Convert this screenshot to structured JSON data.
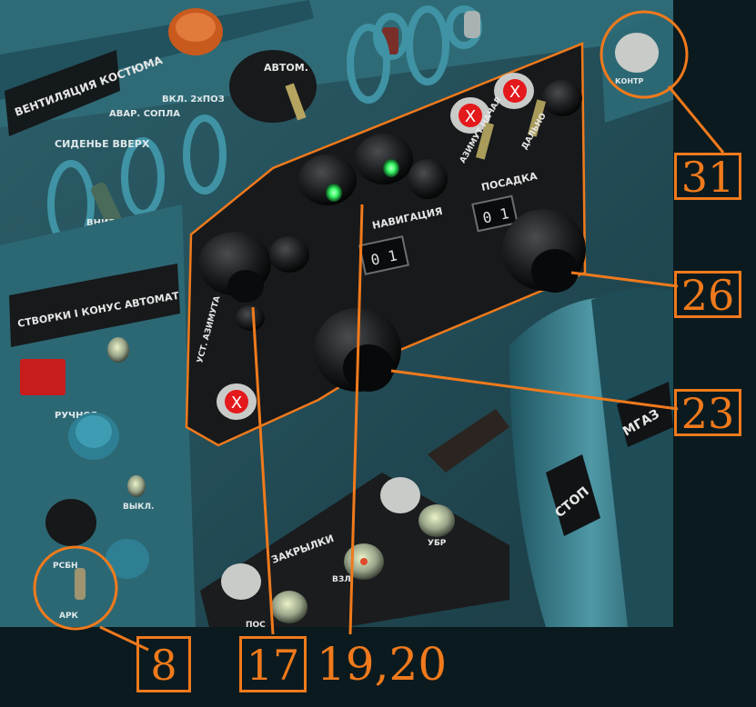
{
  "callouts": {
    "c31": "31",
    "c26": "26",
    "c23": "23",
    "c8": "8",
    "c17": "17",
    "c1920": "19,20"
  },
  "panel_labels": {
    "suit_vent": "ВЕНТИЛЯЦИЯ КОСТЮМА",
    "auto": "АВТОМ.",
    "manual_left": "РУЧН.",
    "avar_sopla": "АВАР. СОПЛА",
    "vkl_2khpoz": "ВКЛ. 2хПОЗ",
    "seat_up": "СИДЕНЬЕ ВВЕРХ",
    "down": "ВНИЗ",
    "stvorki": "СТВОРКИ І КОНУС АВТОМАТ",
    "ruchnoe": "РУЧНОЕ",
    "vykl": "ВЫКЛ.",
    "navigatsiya": "НАВИГАЦИЯ",
    "posadka": "ПОСАДКА",
    "azimut_nach": "АЗИМУТ НАЧАЛ",
    "dalno": "ДАЛЬНО",
    "ust": "УСТ.",
    "ust_azimuta": "УСТ. АЗИМУТА",
    "nav_display": "0 1",
    "land_display": "0 1",
    "stop": "СТОП",
    "mgaz": "МГАЗ",
    "zakrylki": "ЗАКРЫЛКИ",
    "ubr": "УБР",
    "vzl": "ВЗЛ",
    "pos": "ПОС",
    "ark": "АРК",
    "rsbn": "РСБН",
    "kontr": "КОНТР"
  },
  "x_mark": "X",
  "colors": {
    "callout": "#f07a1c",
    "panel_blue": "#3f7f8c",
    "panel_black": "#17191b",
    "indicator_green": "#3dff6a",
    "x_marker": "#e3191c"
  }
}
